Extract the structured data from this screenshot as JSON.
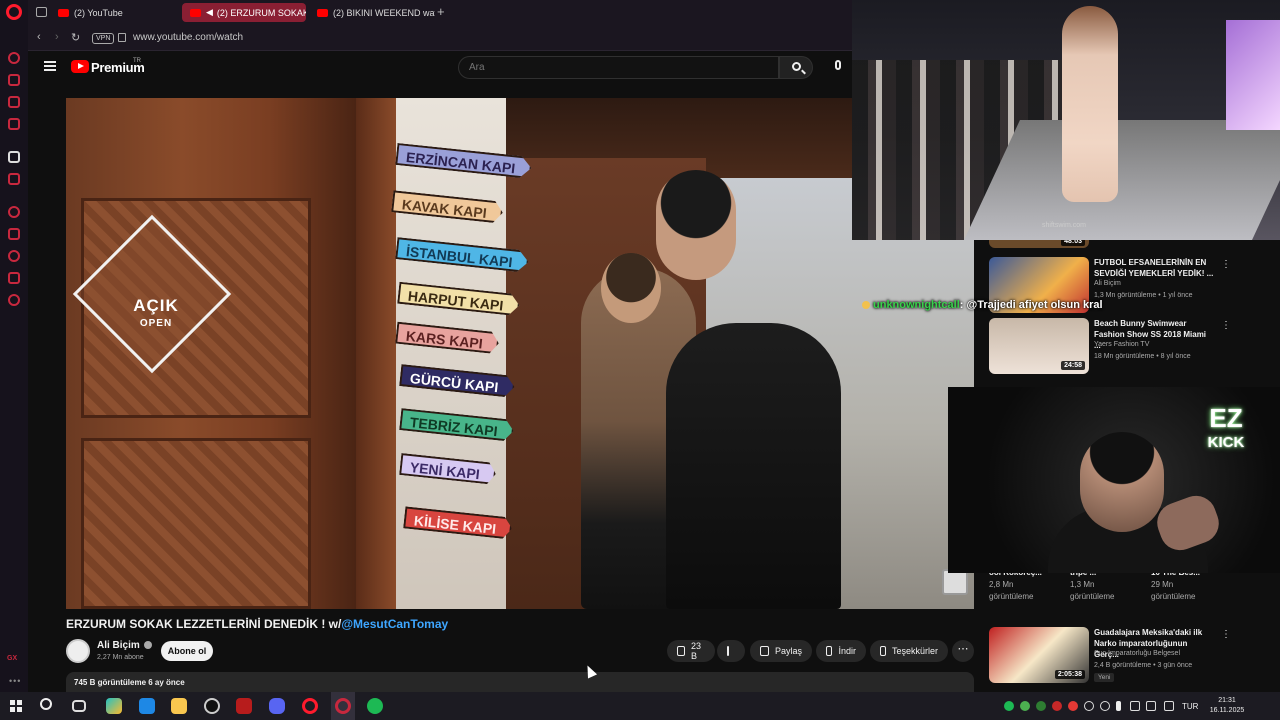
{
  "browser": {
    "tabs": [
      {
        "label": "(2) YouTube",
        "active": false
      },
      {
        "label": "(2) ERZURUM SOKAK",
        "active": true
      },
      {
        "label": "(2) BIKINI WEEKEND wat",
        "active": false
      }
    ],
    "vpn_label": "VPN",
    "url": "www.youtube.com/watch"
  },
  "youtube": {
    "brand": "Premium",
    "brand_sup": "TR",
    "search_placeholder": "Ara"
  },
  "video": {
    "title": "ERZURUM SOKAK LEZZETLERİNİ DENEDİK ! w/",
    "mention": "@MesutCanTomay",
    "shop_sign": {
      "big": "AÇIK",
      "small": "OPEN"
    },
    "signposts": [
      "ERZİNCAN KAPI",
      "KAVAK KAPI",
      "İSTANBUL KAPI",
      "HARPUT KAPI",
      "KARS KAPI",
      "GÜRCÜ KAPI",
      "TEBRİZ KAPI",
      "YENİ KAPI",
      "KİLİSE KAPI"
    ],
    "channel": "Ali Biçim",
    "subscribers": "2,27 Mn abone",
    "subscribe_label": "Abone ol",
    "like_count": "23 B",
    "share_label": "Paylaş",
    "download_label": "İndir",
    "thanks_label": "Teşekkürler",
    "more_label": "⋯",
    "views_date": "745 B görüntüleme  6 ay önce"
  },
  "recommendations": [
    {
      "title": "FUTBOL EFSANELERİNİN EN SEVDİĞİ YEMEKLERİ YEDİK! ...",
      "channel": "Ali Biçim",
      "meta": "1,3 Mn görüntüleme • 1 yıl önce",
      "duration": "",
      "thumb_color": "#3b5998"
    },
    {
      "title": "Beach Bunny Swimwear Fashion Show SS 2018 Miami ...",
      "channel": "Yaers Fashion TV",
      "meta": "18 Mn görüntüleme • 8 yıl önce",
      "duration": "24:58",
      "thumb_color": "#b9a79a"
    },
    {
      "title": "Guadalajara Meksika'daki ilk Narko imparatorluğunun Gerç...",
      "channel": "Suç İmparatorluğu Belgesel",
      "meta": "2,4 B görüntüleme • 3 gün önce",
      "duration": "2:05:38",
      "new_badge": "Yeni",
      "thumb_color": "#8a1f1f"
    }
  ],
  "top_partial_duration": "48:03",
  "grid_row": [
    {
      "title": "ooi Kokoreç...",
      "views": "2,8 Mn",
      "suffix": "görüntüleme"
    },
    {
      "title": "tripe ...",
      "views": "1,3 Mn",
      "suffix": "görüntüleme"
    },
    {
      "title": "10 The Bes...",
      "views": "29 Mn",
      "suffix": "görüntüleme"
    }
  ],
  "overlay": {
    "runway_watermark": "shiftswim.com",
    "kick_ez": "EZ",
    "kick_text": "KICK",
    "chat_user": "unknownightcall",
    "chat_msg": ": @Trajjedi afiyet olsun kral"
  },
  "taskbar": {
    "lang": "TUR",
    "time": "21:31",
    "date": "16.11.2025"
  }
}
